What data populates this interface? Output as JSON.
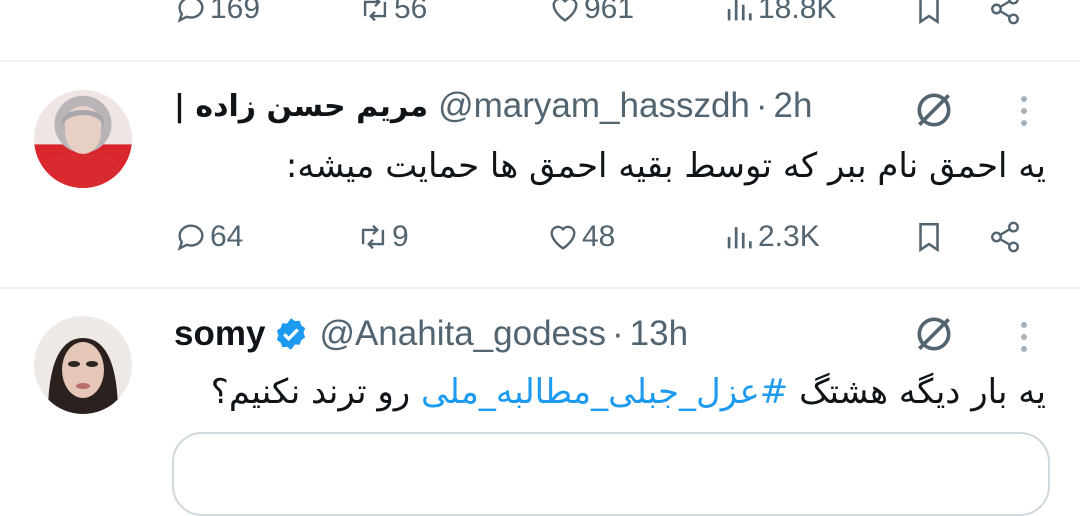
{
  "top_tweet": {
    "stats": {
      "replies": "169",
      "retweets": "56",
      "likes": "961",
      "views": "18.8K"
    }
  },
  "tweet1": {
    "name": "مریم حسن زاده |",
    "handle": "@maryam_hasszdh",
    "time": "2h",
    "text": "یه احمق نام ببر که توسط بقیه احمق ها حمایت میشه:",
    "stats": {
      "replies": "64",
      "retweets": "9",
      "likes": "48",
      "views": "2.3K"
    }
  },
  "tweet2": {
    "name": "somy",
    "handle": "@Anahita_godess",
    "time": "13h",
    "text_before": "یه بار دیگه هشتگ",
    "hashtag": "#عزل_جبلی_مطالبه_ملی",
    "text_after": "رو ترند نکنیم؟"
  },
  "colors": {
    "accent": "#1d9bf0",
    "muted": "#536471",
    "text": "#0f1419"
  }
}
